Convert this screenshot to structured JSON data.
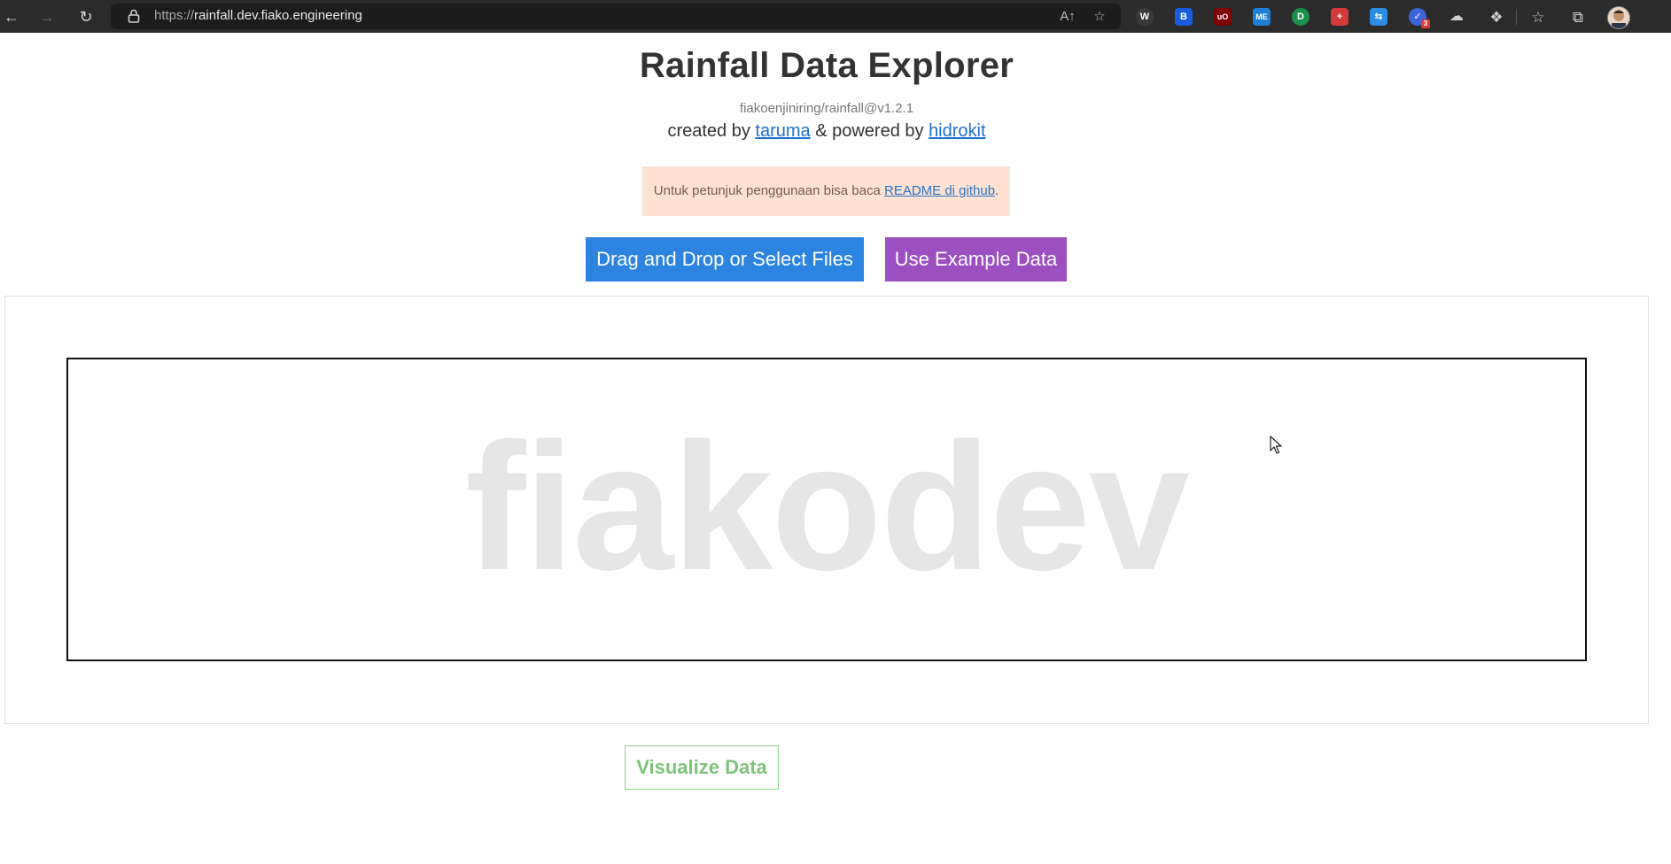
{
  "browser": {
    "url_protocol": "https://",
    "url_host": "rainfall.dev.fiako.engineering",
    "icons": [
      "back-arrow-icon",
      "forward-arrow-icon",
      "refresh-icon",
      "lock-icon",
      "read-aloud-icon",
      "add-favorite-icon",
      "favorites-icon",
      "collections-icon",
      "extensions-icon",
      "profile-avatar"
    ],
    "extensions": [
      {
        "name": "ext-w",
        "label": "W",
        "color": "#3a3a3a"
      },
      {
        "name": "ext-bitwarden",
        "label": "B",
        "color": "#175ddc"
      },
      {
        "name": "ext-ublock",
        "label": "uO",
        "color": "#800000"
      },
      {
        "name": "ext-mx",
        "label": "ME",
        "color": "#1d7fd6"
      },
      {
        "name": "ext-d",
        "label": "D",
        "color": "#1a8f4a"
      },
      {
        "name": "ext-plus",
        "label": "+",
        "color": "#d33b3b"
      },
      {
        "name": "ext-translate",
        "label": "⇆",
        "color": "#2a8de3"
      },
      {
        "name": "ext-check",
        "label": "✓",
        "color": "#3f63d9"
      },
      {
        "name": "ext-cloud",
        "label": "☁",
        "color": "#555555"
      }
    ],
    "ext_badge": "3"
  },
  "page": {
    "title": "Rainfall Data Explorer",
    "version": "fiakoenjiniring/rainfall@v1.2.1",
    "credits_prefix": "created by ",
    "credits_author": "taruma",
    "credits_middle": " & powered by ",
    "credits_lib": "hidrokit",
    "notice_text": "Untuk petunjuk penggunaan bisa baca ",
    "notice_link": "README di github",
    "notice_suffix": "."
  },
  "actions": {
    "upload_label": "Drag and Drop or Select Files",
    "example_label": "Use Example Data",
    "visualize_label": "Visualize Data"
  },
  "canvas": {
    "watermark": "fiakodev"
  },
  "colors": {
    "upload_button": "#2c84e0",
    "example_button": "#9b4fc0",
    "visualize_button": "#7cc47a",
    "notice_bg": "#fde2d3",
    "link": "#1e6fd0"
  }
}
